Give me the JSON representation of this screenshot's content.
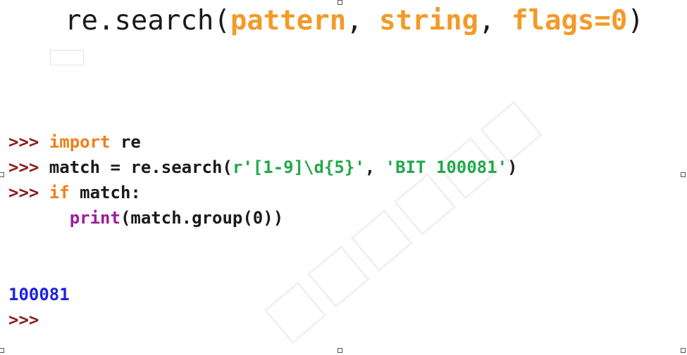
{
  "signature": {
    "func": "re.search(",
    "param1": "pattern",
    "sep1": ", ",
    "param2": "string",
    "sep2": ", ",
    "param3": "flags=0",
    "close": ")"
  },
  "code_lines": {
    "l1": {
      "prompt": ">>> ",
      "kw": "import",
      "rest": " re"
    },
    "l2": {
      "prompt": ">>> ",
      "pre": "match = re.search(",
      "str1": "r'[1-9]\\d{5}'",
      "mid": ", ",
      "str2": "'BIT 100081'",
      "post": ")"
    },
    "l3": {
      "prompt": ">>> ",
      "kw": "if",
      "rest": " match:"
    },
    "l4": {
      "indent": "      ",
      "kw": "print",
      "rest": "(match.group(0))"
    }
  },
  "output": {
    "value": "100081",
    "prompt": ">>>"
  },
  "colors": {
    "param": "#f39a28",
    "prompt": "#8b1e1e",
    "keyword": "#f07f1a",
    "builtin": "#9c1c9c",
    "string": "#22a84a",
    "output": "#1c22e0"
  }
}
